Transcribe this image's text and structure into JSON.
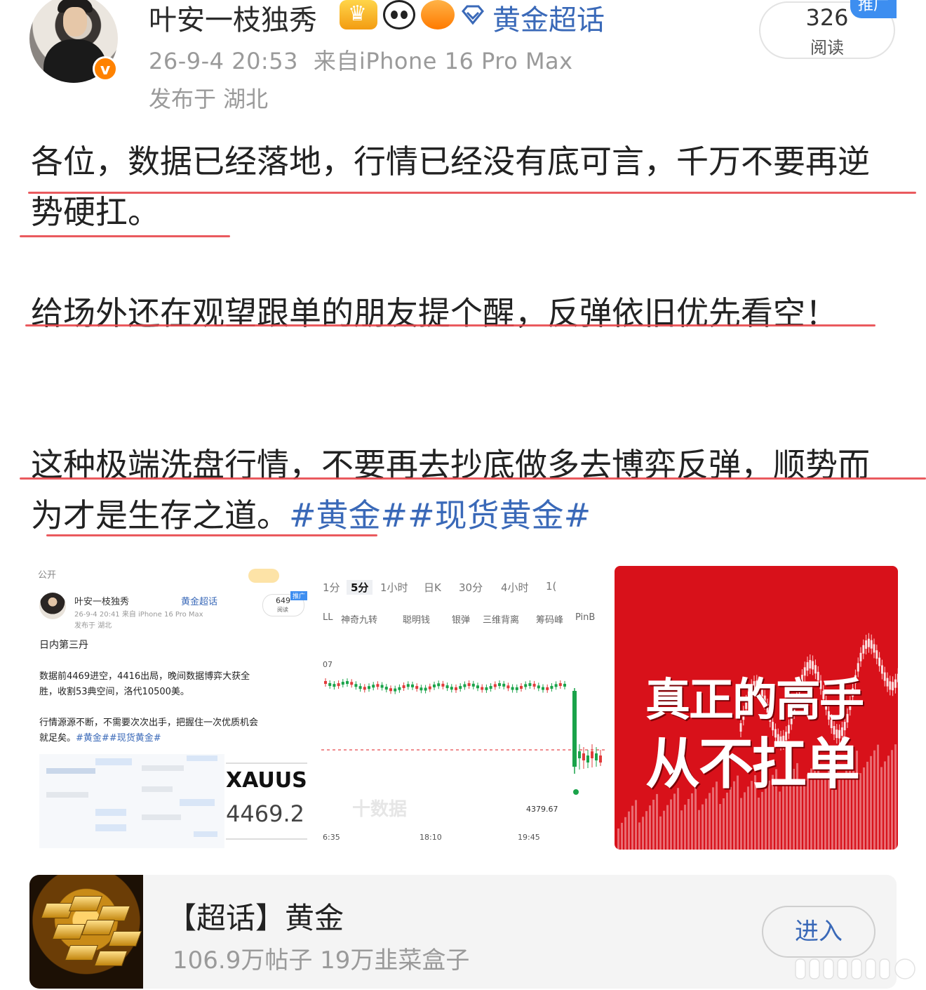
{
  "post": {
    "author": "叶安一枝独秀",
    "supertopic_tag": "黄金超话",
    "time": "26-9-4 20:53",
    "source": "来自iPhone 16 Pro Max",
    "location": "发布于 湖北",
    "reads": "326",
    "reads_label": "阅读",
    "ad_tag": "推广",
    "paragraphs": [
      "各位，数据已经落地，行情已经没有底可言，千万不要再逆势硬扛。",
      "给场外还在观望跟单的朋友提个醒，反弹依旧优先看空！",
      "这种极端洗盘行情，不要再去抄底做多去博弈反弹，顺势而为才是生存之道。"
    ],
    "hashtags": "#黄金##现货黄金#"
  },
  "images": {
    "img1": {
      "visibility": "公开",
      "author": "叶安一枝独秀",
      "tag": "黄金超话",
      "meta": "26-9-4 20:41  来自 iPhone 16 Pro Max",
      "location": "发布于 湖北",
      "reads": "649",
      "reads_label": "阅读",
      "ad_tag": "推广",
      "line1": "日内第三丹",
      "line2a": "数据前4469进空，4416出局，晚间数据博弈大获全",
      "line2b": "胜，收割53典空间，洛代10500美。",
      "line3a": "行情源源不断，不需要次次出手，把握住一次优质机会",
      "line3b": "就足矣。",
      "hashtags": "#黄金##现货黄金#",
      "symbol": "XAUUSD",
      "price": "4469.2"
    },
    "img2": {
      "tabs": [
        "1分",
        "5分",
        "1小时",
        "日K",
        "30分",
        "4小时",
        "1("
      ],
      "tab_active": "5分",
      "indicators": [
        "LL",
        "神奇九转",
        "聪明钱",
        "银弹",
        "三维背离",
        "筹码峰",
        "PinB"
      ],
      "y_label": "07",
      "price_label": "4379.67",
      "times": [
        "6:35",
        "18:10",
        "19:45"
      ],
      "watermark": "十数据"
    },
    "img3": {
      "line1": "真正的高手",
      "line2": "从不扛单"
    }
  },
  "topic_card": {
    "title": "【超话】黄金",
    "stats": "106.9万帖子 19万韭菜盒子",
    "button": "进入"
  },
  "colors": {
    "link_blue": "#3a69b8",
    "underline_red": "#e8484c",
    "verified_orange": "#ff8200",
    "poster_red": "#d8111a"
  }
}
